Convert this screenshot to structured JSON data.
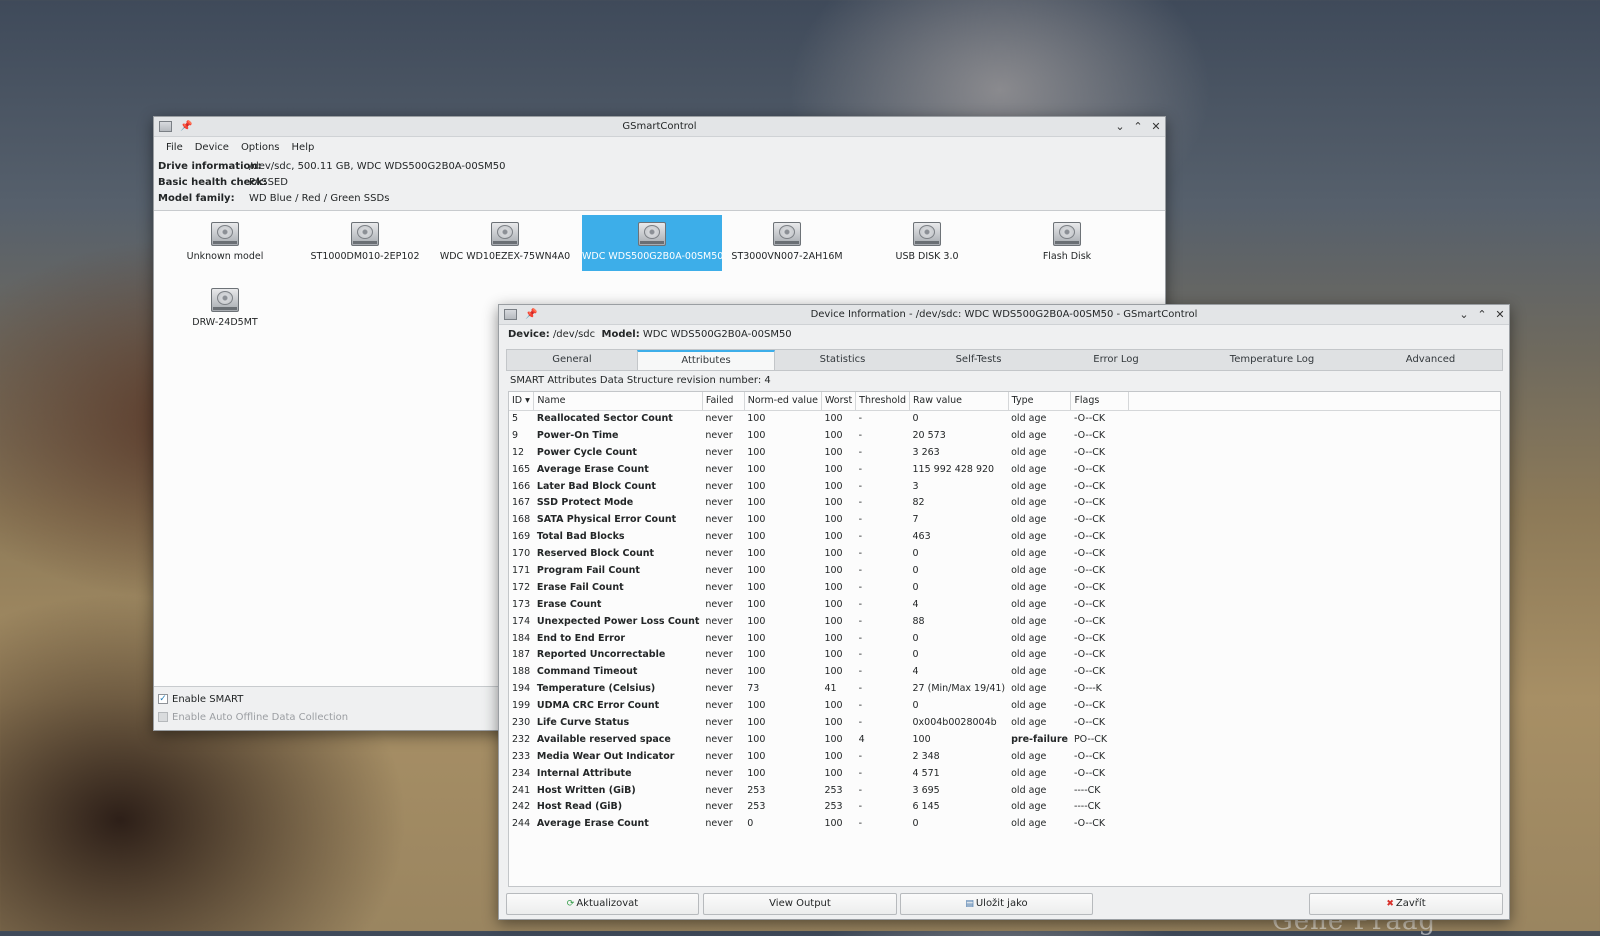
{
  "wallpaper": {
    "text": "Gene Praag"
  },
  "main_window": {
    "title": "GSmartControl",
    "menu": [
      "File",
      "Device",
      "Options",
      "Help"
    ],
    "drive_info": {
      "drive_label": "Drive information:",
      "drive_value": "/dev/sdc, 500.11 GB, WDC WDS500G2B0A-00SM50",
      "health_label": "Basic health check:",
      "health_value": "PASSED",
      "family_label": "Model family:",
      "family_value": "WD Blue / Red / Green SSDs"
    },
    "drives": [
      {
        "label": "Unknown model",
        "selected": false
      },
      {
        "label": "ST1000DM010-2EP102",
        "selected": false
      },
      {
        "label": "WDC WD10EZEX-75WN4A0",
        "selected": false
      },
      {
        "label": "WDC WDS500G2B0A-00SM50",
        "selected": true
      },
      {
        "label": "ST3000VN007-2AH16M",
        "selected": false
      },
      {
        "label": "USB DISK 3.0",
        "selected": false
      },
      {
        "label": "Flash Disk",
        "selected": false
      },
      {
        "label": "DRW-24D5MT",
        "selected": false
      }
    ],
    "enable_smart": {
      "label": "Enable SMART",
      "checked": true
    },
    "enable_auto_offline": {
      "label": "Enable Auto Offline Data Collection",
      "checked": false,
      "disabled": true
    }
  },
  "device_window": {
    "title": "Device Information - /dev/sdc: WDC WDS500G2B0A-00SM50 - GSmartControl",
    "device_label": "Device:",
    "device_value": "/dev/sdc",
    "model_label": "Model:",
    "model_value": "WDC WDS500G2B0A-00SM50",
    "tabs": [
      "General",
      "Attributes",
      "Statistics",
      "Self-Tests",
      "Error Log",
      "Temperature Log",
      "Advanced"
    ],
    "active_tab": "Attributes",
    "revision_text": "SMART Attributes Data Structure revision number: 4",
    "columns": [
      "ID",
      "Name",
      "Failed",
      "Norm-ed value",
      "Worst",
      "Threshold",
      "Raw value",
      "Type",
      "Flags"
    ],
    "rows": [
      [
        "5",
        "Reallocated Sector Count",
        "never",
        "100",
        "100",
        "-",
        "0",
        "old age",
        "-O--CK"
      ],
      [
        "9",
        "Power-On Time",
        "never",
        "100",
        "100",
        "-",
        "20 573",
        "old age",
        "-O--CK"
      ],
      [
        "12",
        "Power Cycle Count",
        "never",
        "100",
        "100",
        "-",
        "3 263",
        "old age",
        "-O--CK"
      ],
      [
        "165",
        "Average Erase Count",
        "never",
        "100",
        "100",
        "-",
        "115 992 428 920",
        "old age",
        "-O--CK"
      ],
      [
        "166",
        "Later Bad Block Count",
        "never",
        "100",
        "100",
        "-",
        "3",
        "old age",
        "-O--CK"
      ],
      [
        "167",
        "SSD Protect Mode",
        "never",
        "100",
        "100",
        "-",
        "82",
        "old age",
        "-O--CK"
      ],
      [
        "168",
        "SATA Physical Error Count",
        "never",
        "100",
        "100",
        "-",
        "7",
        "old age",
        "-O--CK"
      ],
      [
        "169",
        "Total Bad Blocks",
        "never",
        "100",
        "100",
        "-",
        "463",
        "old age",
        "-O--CK"
      ],
      [
        "170",
        "Reserved Block Count",
        "never",
        "100",
        "100",
        "-",
        "0",
        "old age",
        "-O--CK"
      ],
      [
        "171",
        "Program Fail Count",
        "never",
        "100",
        "100",
        "-",
        "0",
        "old age",
        "-O--CK"
      ],
      [
        "172",
        "Erase Fail Count",
        "never",
        "100",
        "100",
        "-",
        "0",
        "old age",
        "-O--CK"
      ],
      [
        "173",
        "Erase Count",
        "never",
        "100",
        "100",
        "-",
        "4",
        "old age",
        "-O--CK"
      ],
      [
        "174",
        "Unexpected Power Loss Count",
        "never",
        "100",
        "100",
        "-",
        "88",
        "old age",
        "-O--CK"
      ],
      [
        "184",
        "End to End Error",
        "never",
        "100",
        "100",
        "-",
        "0",
        "old age",
        "-O--CK"
      ],
      [
        "187",
        "Reported Uncorrectable",
        "never",
        "100",
        "100",
        "-",
        "0",
        "old age",
        "-O--CK"
      ],
      [
        "188",
        "Command Timeout",
        "never",
        "100",
        "100",
        "-",
        "4",
        "old age",
        "-O--CK"
      ],
      [
        "194",
        "Temperature (Celsius)",
        "never",
        "73",
        "41",
        "-",
        "27 (Min/Max 19/41)",
        "old age",
        "-O---K"
      ],
      [
        "199",
        "UDMA CRC Error Count",
        "never",
        "100",
        "100",
        "-",
        "0",
        "old age",
        "-O--CK"
      ],
      [
        "230",
        "Life Curve Status",
        "never",
        "100",
        "100",
        "-",
        "0x004b0028004b",
        "old age",
        "-O--CK"
      ],
      [
        "232",
        "Available reserved space",
        "never",
        "100",
        "100",
        "4",
        "100",
        "pre-failure",
        "PO--CK"
      ],
      [
        "233",
        "Media Wear Out Indicator",
        "never",
        "100",
        "100",
        "-",
        "2 348",
        "old age",
        "-O--CK"
      ],
      [
        "234",
        "Internal Attribute",
        "never",
        "100",
        "100",
        "-",
        "4 571",
        "old age",
        "-O--CK"
      ],
      [
        "241",
        "Host Written (GiB)",
        "never",
        "253",
        "253",
        "-",
        "3 695",
        "old age",
        "----CK"
      ],
      [
        "242",
        "Host Read (GiB)",
        "never",
        "253",
        "253",
        "-",
        "6 145",
        "old age",
        "----CK"
      ],
      [
        "244",
        "Average Erase Count",
        "never",
        "0",
        "100",
        "-",
        "0",
        "old age",
        "-O--CK"
      ]
    ],
    "buttons": {
      "refresh": "Aktualizovat",
      "view_output": "View Output",
      "save_as": "Uložit jako",
      "close": "Zavřít"
    }
  },
  "colors": {
    "selection": "#3daee9",
    "window_bg": "#eff0f1"
  }
}
